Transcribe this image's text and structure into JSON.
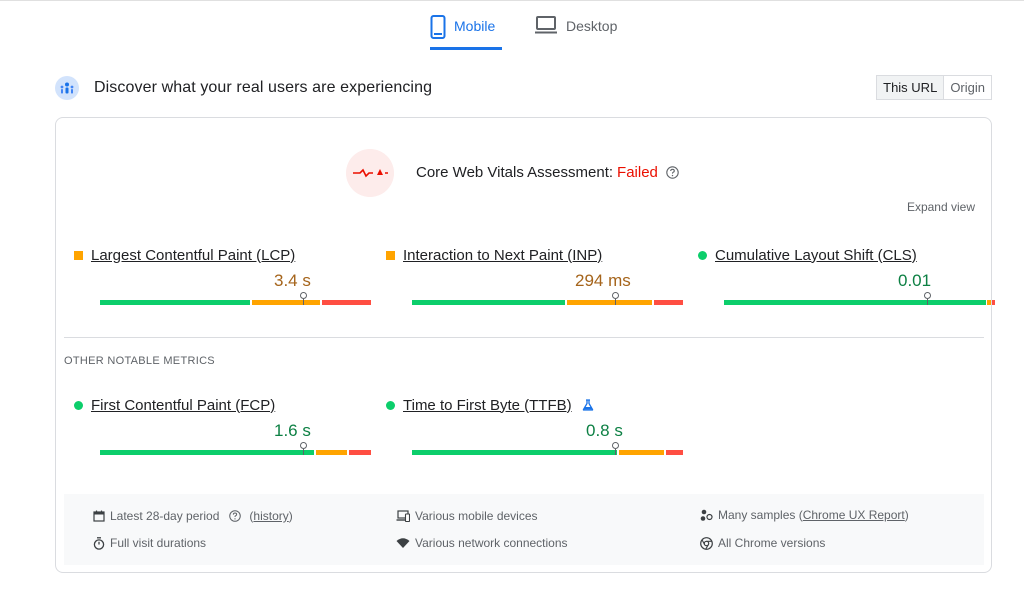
{
  "tabs": [
    {
      "label": "Mobile",
      "active": true,
      "icon": "smartphone-icon"
    },
    {
      "label": "Desktop",
      "active": false,
      "icon": "laptop-icon"
    }
  ],
  "header": {
    "title": "Discover what your real users are experiencing",
    "icon": "crux-users-icon",
    "toggle": [
      {
        "label": "This URL",
        "active": true
      },
      {
        "label": "Origin",
        "active": false
      }
    ]
  },
  "assessment": {
    "label": "Core Web Vitals Assessment:",
    "status": "Failed",
    "status_color": "#eb0f00",
    "expand": "Expand view"
  },
  "core_metrics": [
    {
      "name": "Largest Contentful Paint (LCP)",
      "value": "3.4 s",
      "rating": "average",
      "distribution": {
        "good": 56,
        "needs_improvement": 19,
        "poor": 19
      },
      "marker_fraction": 0.75
    },
    {
      "name": "Interaction to Next Paint (INP)",
      "value": "294 ms",
      "rating": "average",
      "distribution": {
        "good": 57,
        "needs_improvement": 27,
        "poor": 11
      },
      "marker_fraction": 0.75
    },
    {
      "name": "Cumulative Layout Shift (CLS)",
      "value": "0.01",
      "rating": "good",
      "distribution": {
        "good": 98,
        "needs_improvement": 1,
        "poor": 1
      },
      "marker_fraction": 0.75
    }
  ],
  "other_section_title": "OTHER NOTABLE METRICS",
  "other_metrics": [
    {
      "name": "First Contentful Paint (FCP)",
      "value": "1.6 s",
      "rating": "good",
      "distribution": {
        "good": 79,
        "needs_improvement": 12,
        "poor": 9
      },
      "marker_fraction": 0.75
    },
    {
      "name": "Time to First Byte (TTFB)",
      "value": "0.8 s",
      "rating": "good",
      "experimental_icon": "flask-icon",
      "distribution": {
        "good": 76,
        "needs_improvement": 17,
        "poor": 7
      },
      "marker_fraction": 0.75
    }
  ],
  "footer": {
    "period": "Latest 28-day period",
    "history_link": "history",
    "devices": "Various mobile devices",
    "samples_prefix": "Many samples (",
    "samples_link": "Chrome UX Report",
    "samples_suffix": ")",
    "durations": "Full visit durations",
    "network": "Various network connections",
    "versions": "All Chrome versions"
  },
  "colors": {
    "good": "#0cce6b",
    "needs_improvement": "#ffa400",
    "poor": "#ff4e42",
    "accent": "#1a73e8"
  }
}
